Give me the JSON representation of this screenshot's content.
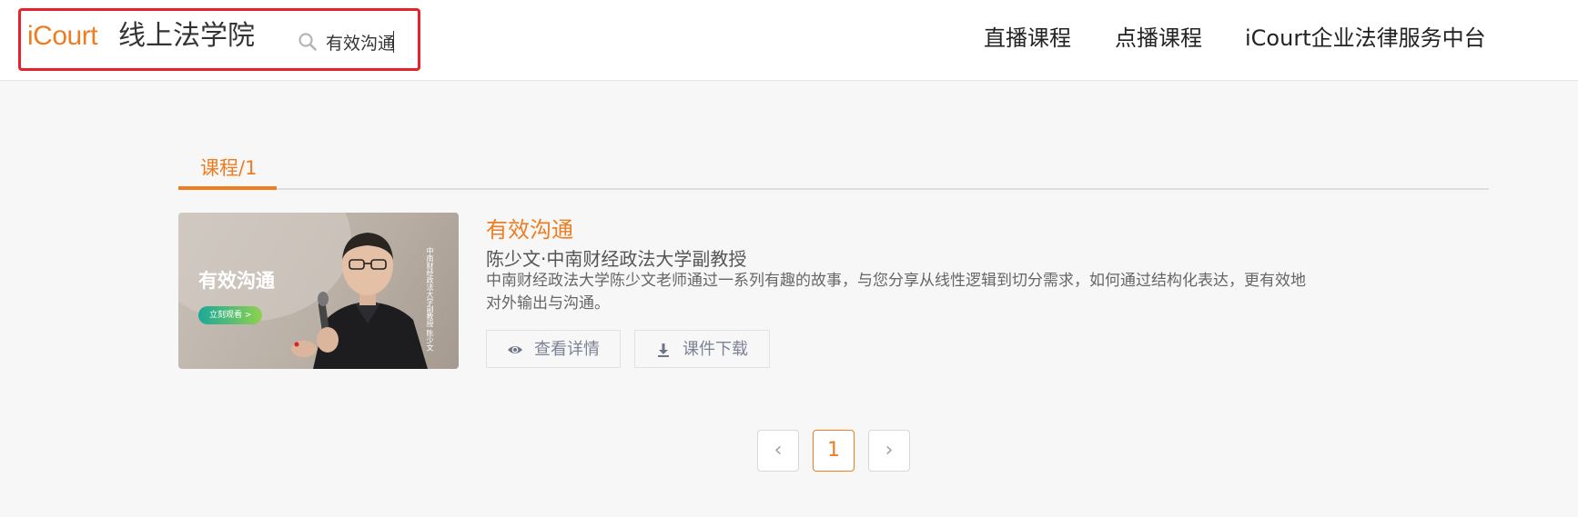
{
  "header": {
    "logo": "iCourt",
    "site_title": "线上法学院",
    "search": {
      "value": "有效沟通",
      "icon": "search-icon"
    },
    "nav": [
      {
        "label": "直播课程"
      },
      {
        "label": "点播课程"
      },
      {
        "label": "iCourt企业法律服务中台"
      }
    ]
  },
  "tabs": [
    {
      "label": "课程/1",
      "active": true
    }
  ],
  "course": {
    "thumbnail": {
      "title": "有效沟通",
      "button": "立刻观看 >",
      "side_text": "中南财经政法大学副教授 陈少文"
    },
    "title": "有效沟通",
    "teacher": "陈少文·中南财经政法大学副教授",
    "description": "中南财经政法大学陈少文老师通过一系列有趣的故事，与您分享从线性逻辑到切分需求，如何通过结构化表达，更有效地对外输出与沟通。",
    "buttons": {
      "details": "查看详情",
      "download": "课件下载"
    }
  },
  "pagination": {
    "prev": "‹",
    "current": "1",
    "next": "›"
  },
  "colors": {
    "accent": "#ee7d22",
    "highlight": "#e8222a"
  }
}
